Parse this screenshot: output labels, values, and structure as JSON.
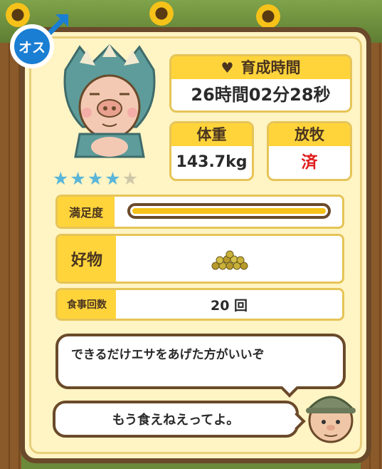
{
  "gender": {
    "label": "オス"
  },
  "rating": {
    "stars": 4,
    "max": 5
  },
  "growth_time": {
    "label": "育成時間",
    "value": "26時間02分28秒"
  },
  "weight": {
    "label": "体重",
    "value": "143.7kg"
  },
  "grazing": {
    "label": "放牧",
    "value": "済"
  },
  "satisfaction": {
    "label": "満足度",
    "level": 1.0
  },
  "favorite": {
    "label": "好物",
    "icon": "feed-pellets-icon"
  },
  "meals": {
    "label": "食事回数",
    "value": "20 回"
  },
  "dialogue": {
    "line1": "できるだけエサをあげた方がいいぞ",
    "line2": "もう食えねえってよ。"
  },
  "colors": {
    "accent": "#ffd43b",
    "border": "#6a4a2a",
    "male": "#1a7ed3",
    "star": "#5ab6d8",
    "alert": "#e01a1a"
  }
}
